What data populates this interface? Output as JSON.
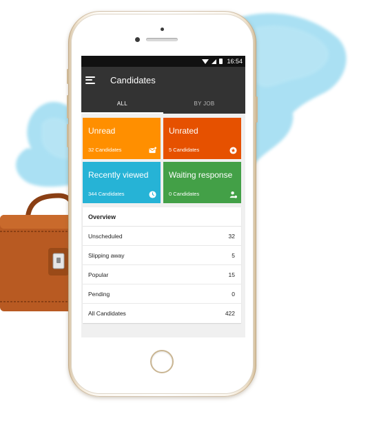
{
  "status_bar": {
    "time": "16:54"
  },
  "app_bar": {
    "title": "Candidates"
  },
  "tabs": [
    {
      "label": "ALL",
      "active": true
    },
    {
      "label": "BY JOB",
      "active": false
    }
  ],
  "tiles": [
    {
      "title": "Unread",
      "count": "32 Candidates",
      "color": "#ff8f00",
      "icon": "mail-icon"
    },
    {
      "title": "Unrated",
      "count": "5 Candidates",
      "color": "#e65100",
      "icon": "star-badge-icon"
    },
    {
      "title": "Recently viewed",
      "count": "344 Candidates",
      "color": "#26b3d6",
      "icon": "clock-icon"
    },
    {
      "title": "Waiting response",
      "count": "0 Candidates",
      "color": "#43a047",
      "icon": "person-add-icon"
    }
  ],
  "overview": {
    "heading": "Overview",
    "rows": [
      {
        "label": "Unscheduled",
        "value": "32"
      },
      {
        "label": "Slipping away",
        "value": "5"
      },
      {
        "label": "Popular",
        "value": "15"
      },
      {
        "label": "Pending",
        "value": "0"
      },
      {
        "label": "All Candidates",
        "value": "422"
      }
    ]
  },
  "colors": {
    "appbar": "#333333",
    "status_bar": "#111111",
    "splash": "#7fd0ec",
    "briefcase": "#b85a22"
  }
}
